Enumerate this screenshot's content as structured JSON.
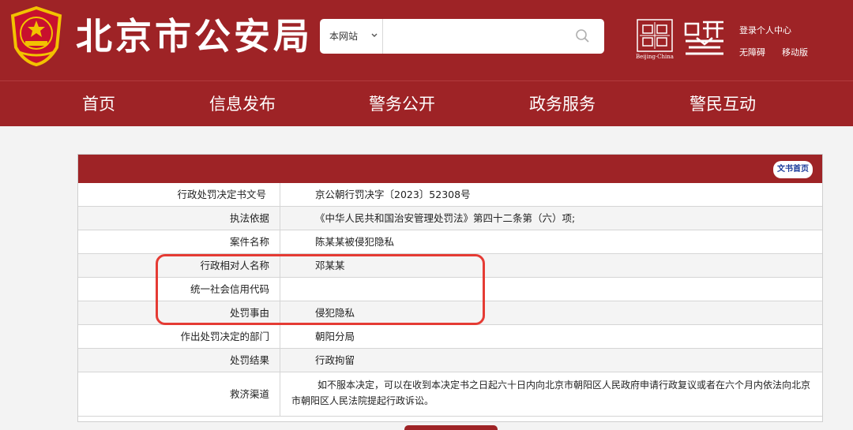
{
  "header": {
    "site_title": "北京市公安局",
    "search": {
      "scope": "本网站",
      "placeholder": ""
    },
    "capital_tag": "Beijing·China",
    "links": {
      "login": "登录个人中心",
      "accessibility": "无障碍",
      "mobile": "移动版"
    }
  },
  "nav": {
    "items": [
      "首页",
      "信息发布",
      "警务公开",
      "政务服务",
      "警民互动"
    ]
  },
  "panel": {
    "doc_home": "文书首页",
    "rows": [
      {
        "label": "行政处罚决定书文号",
        "value": "京公朝行罚决字〔2023〕52308号"
      },
      {
        "label": "执法依据",
        "value": "《中华人民共和国治安管理处罚法》第四十二条第（六）项;"
      },
      {
        "label": "案件名称",
        "value": "陈某某被侵犯隐私"
      },
      {
        "label": "行政相对人名称",
        "value": "邓某某"
      },
      {
        "label": "统一社会信用代码",
        "value": ""
      },
      {
        "label": "处罚事由",
        "value": "侵犯隐私"
      },
      {
        "label": "作出处罚决定的部门",
        "value": "朝阳分局"
      },
      {
        "label": "处罚结果",
        "value": "行政拘留"
      },
      {
        "label": "救济渠道",
        "value": "如不服本决定，可以在收到本决定书之日起六十日内向北京市朝阳区人民政府申请行政复议或者在六个月内依法向北京市朝阳区人民法院提起行政诉讼。"
      }
    ]
  },
  "colors": {
    "brand_red": "#9e2326",
    "highlight_red": "#e53b34",
    "link_blue": "#1a3a9a"
  },
  "icons": [
    "police-emblem-icon",
    "chevron-down-icon",
    "search-icon",
    "capital-logo-icon",
    "police-badge-icon"
  ]
}
